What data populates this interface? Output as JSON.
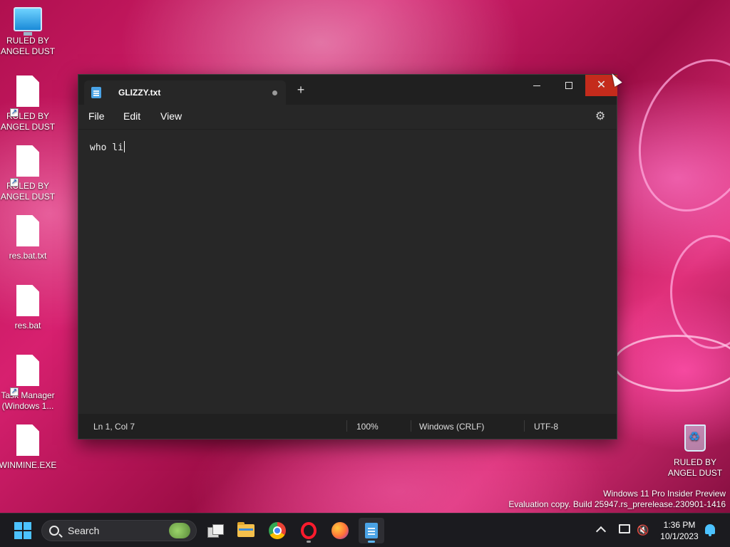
{
  "desktop": {
    "icons": [
      {
        "label": "RULED BY ANGEL DUST",
        "icon": "monitor-icon"
      },
      {
        "label": "RULED BY ANGEL DUST",
        "icon": "shortcut-file-icon"
      },
      {
        "label": "RULED BY ANGEL DUST",
        "icon": "shortcut-file-icon"
      },
      {
        "label": "res.bat.txt",
        "icon": "file-icon"
      },
      {
        "label": "res.bat",
        "icon": "file-icon"
      },
      {
        "label": "Task Manager (Windows 1...",
        "icon": "shortcut-file-icon"
      },
      {
        "label": "WINMINE.EXE",
        "icon": "file-icon"
      }
    ],
    "recycle_bin": {
      "label": "RULED BY ANGEL DUST",
      "icon": "recycle-bin-icon"
    },
    "watermark": {
      "line1": "Windows 11 Pro Insider Preview",
      "line2": "Evaluation copy. Build 25947.rs_prerelease.230901-1416"
    }
  },
  "notepad": {
    "tab_title": "GLIZZY.txt",
    "new_tab_label": "+",
    "menu": {
      "file": "File",
      "edit": "Edit",
      "view": "View"
    },
    "content": "who li",
    "status": {
      "position": "Ln 1, Col 7",
      "zoom": "100%",
      "line_ending": "Windows (CRLF)",
      "encoding": "UTF-8"
    },
    "close_glyph": "✕",
    "settings_glyph": "⚙"
  },
  "taskbar": {
    "search_label": "Search",
    "apps": [
      "task-view-icon",
      "file-explorer-icon",
      "chrome-icon",
      "opera-icon",
      "firefox-icon",
      "notepad-icon"
    ],
    "clock": {
      "time": "1:36 PM",
      "date": "10/1/2023"
    },
    "volume_glyph": "🔇"
  },
  "colors": {
    "accent": "#4cc2ff",
    "close_button": "#c42b1c",
    "window_bg": "#272727"
  }
}
